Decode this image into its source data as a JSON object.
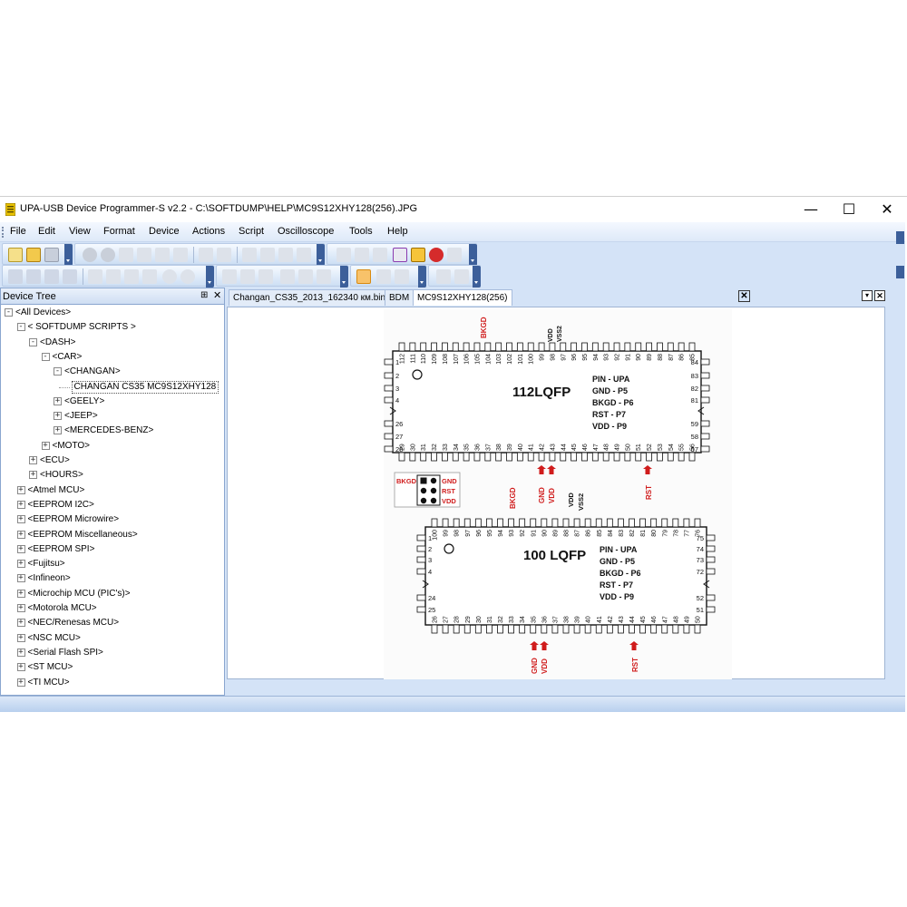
{
  "window": {
    "title": "UPA-USB Device Programmer-S v2.2 - C:\\SOFTDUMP\\HELP\\MC9S12XHY128(256).JPG",
    "minimize_glyph": "—",
    "maximize_glyph": "☐",
    "close_glyph": "✕"
  },
  "menu": [
    "File",
    "Edit",
    "View",
    "Format",
    "Device",
    "Actions",
    "Script",
    "Oscilloscope",
    "Tools",
    "Help"
  ],
  "device_tree": {
    "title": "Device Tree",
    "pin_glyph": "⊞",
    "close_glyph": "✕",
    "items": [
      {
        "label": "<All Devices>",
        "level": 0,
        "sign": "−"
      },
      {
        "label": "< SOFTDUMP SCRIPTS >",
        "level": 1,
        "sign": "−"
      },
      {
        "label": "<DASH>",
        "level": 2,
        "sign": "−"
      },
      {
        "label": "<CAR>",
        "level": 3,
        "sign": "−"
      },
      {
        "label": "<CHANGAN>",
        "level": 4,
        "sign": "−"
      },
      {
        "label": "CHANGAN CS35 MC9S12XHY128",
        "level": 5,
        "sign": ""
      },
      {
        "label": "<GEELY>",
        "level": 4,
        "sign": "+"
      },
      {
        "label": "<JEEP>",
        "level": 4,
        "sign": "+"
      },
      {
        "label": "<MERCEDES-BENZ>",
        "level": 4,
        "sign": "+"
      },
      {
        "label": "<MOTO>",
        "level": 3,
        "sign": "+"
      },
      {
        "label": "<ECU>",
        "level": 2,
        "sign": "+"
      },
      {
        "label": "<HOURS>",
        "level": 2,
        "sign": "+"
      },
      {
        "label": "<Atmel MCU>",
        "level": 1,
        "sign": "+"
      },
      {
        "label": "<EEPROM I2C>",
        "level": 1,
        "sign": "+"
      },
      {
        "label": "<EEPROM Microwire>",
        "level": 1,
        "sign": "+"
      },
      {
        "label": "<EEPROM Miscellaneous>",
        "level": 1,
        "sign": "+"
      },
      {
        "label": "<EEPROM SPI>",
        "level": 1,
        "sign": "+"
      },
      {
        "label": "<Fujitsu>",
        "level": 1,
        "sign": "+"
      },
      {
        "label": "<Infineon>",
        "level": 1,
        "sign": "+"
      },
      {
        "label": "<Microchip MCU (PIC's)>",
        "level": 1,
        "sign": "+"
      },
      {
        "label": "<Motorola MCU>",
        "level": 1,
        "sign": "+"
      },
      {
        "label": "<NEC/Renesas MCU>",
        "level": 1,
        "sign": "+"
      },
      {
        "label": "<NSC MCU>",
        "level": 1,
        "sign": "+"
      },
      {
        "label": "<Serial Flash SPI>",
        "level": 1,
        "sign": "+"
      },
      {
        "label": "<ST MCU>",
        "level": 1,
        "sign": "+"
      },
      {
        "label": "<TI MCU>",
        "level": 1,
        "sign": "+"
      }
    ]
  },
  "tabs": [
    {
      "label": "Changan_CS35_2013_162340 км.bin",
      "active": false
    },
    {
      "label": "BDM",
      "active": false
    },
    {
      "label": "MC9S12XHY128(256)",
      "active": true
    }
  ],
  "tab_close_glyph": "✕",
  "doc_controls": [
    "▾",
    "✕"
  ],
  "image": {
    "chip1": {
      "name": "112LQFP",
      "top_pins": [
        "112",
        "111",
        "110",
        "109",
        "108",
        "107",
        "106",
        "105",
        "104",
        "103",
        "102",
        "101",
        "100",
        "99",
        "98",
        "97",
        "96",
        "95",
        "94",
        "93",
        "92",
        "91",
        "90",
        "89",
        "88",
        "87",
        "86",
        "85"
      ],
      "bottom_pins": [
        "29",
        "30",
        "31",
        "32",
        "33",
        "34",
        "35",
        "36",
        "37",
        "38",
        "39",
        "40",
        "41",
        "42",
        "43",
        "44",
        "45",
        "46",
        "47",
        "48",
        "49",
        "50",
        "51",
        "52",
        "53",
        "54",
        "55",
        "56"
      ],
      "left_pins": [
        "1",
        "2",
        "3",
        "4",
        "26",
        "27",
        "28"
      ],
      "right_pins": [
        "84",
        "83",
        "82",
        "81",
        "59",
        "58",
        "57"
      ],
      "table": [
        [
          "PIN",
          "UPA"
        ],
        [
          "GND",
          "P5"
        ],
        [
          "BKGD",
          "P6"
        ],
        [
          "RST",
          "P7"
        ],
        [
          "VDD",
          "P9"
        ]
      ],
      "top_labels": [
        "BKGD",
        "VDD",
        "VSS2"
      ],
      "bottom_labels": [
        "GND",
        "VDD",
        "RST",
        "BKGD",
        "VDD",
        "VSS2"
      ]
    },
    "connector": {
      "labels": [
        "BKGD",
        "GND",
        "RST",
        "VDD"
      ]
    },
    "chip2": {
      "name": "100 LQFP",
      "top_pins": [
        "100",
        "99",
        "98",
        "97",
        "96",
        "95",
        "94",
        "93",
        "92",
        "91",
        "90",
        "89",
        "88",
        "87",
        "86",
        "85",
        "84",
        "83",
        "82",
        "81",
        "80",
        "79",
        "78",
        "77",
        "76"
      ],
      "bottom_pins": [
        "26",
        "27",
        "28",
        "29",
        "30",
        "31",
        "32",
        "33",
        "34",
        "35",
        "36",
        "37",
        "38",
        "39",
        "40",
        "41",
        "42",
        "43",
        "44",
        "45",
        "46",
        "47",
        "48",
        "49",
        "50"
      ],
      "left_pins": [
        "1",
        "2",
        "3",
        "4",
        "24",
        "25"
      ],
      "right_pins": [
        "75",
        "74",
        "73",
        "72",
        "52",
        "51"
      ],
      "table": [
        [
          "PIN",
          "UPA"
        ],
        [
          "GND",
          "P5"
        ],
        [
          "BKGD",
          "P6"
        ],
        [
          "RST",
          "P7"
        ],
        [
          "VDD",
          "P9"
        ]
      ],
      "bottom_labels": [
        "GND",
        "VDD",
        "RST"
      ]
    },
    "colors": {
      "red": "#d01c1c",
      "text": "#111111"
    }
  }
}
